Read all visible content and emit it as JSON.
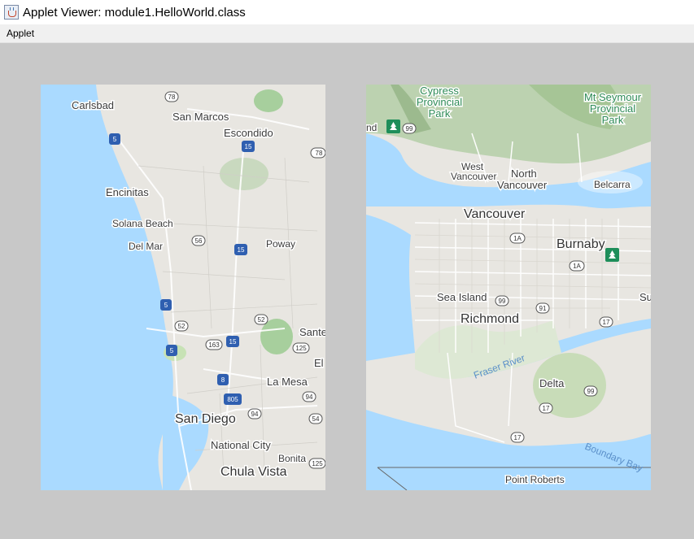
{
  "window": {
    "title": "Applet Viewer: module1.HelloWorld.class"
  },
  "menu": {
    "items": [
      "Applet"
    ]
  },
  "maps": {
    "san_diego": {
      "places": [
        "Carlsbad",
        "San Marcos",
        "Escondido",
        "Encinitas",
        "Solana Beach",
        "Del Mar",
        "Poway",
        "Sante",
        "El Ca",
        "La Mesa",
        "San Diego",
        "National City",
        "Bonita",
        "Chula Vista"
      ],
      "shields": [
        "78",
        "5",
        "15",
        "78",
        "56",
        "15",
        "5",
        "52",
        "52",
        "163",
        "15",
        "5",
        "125",
        "8",
        "805",
        "94",
        "94",
        "54",
        "125"
      ]
    },
    "vancouver": {
      "places": [
        "Cypress",
        "Provincial",
        "Park",
        "Mt Seymour",
        "Provincial",
        "Park",
        "nd",
        "West",
        "Vancouver",
        "North",
        "Vancouver",
        "Belcarra",
        "Vancouver",
        "Burnaby",
        "Sea Island",
        "Richmond",
        "Delta",
        "Point Roberts",
        "Su"
      ],
      "water": [
        "Fraser River",
        "Boundary Bay"
      ],
      "shields": [
        "99",
        "1A",
        "1A",
        "99",
        "91",
        "17",
        "99",
        "17",
        "17"
      ]
    }
  }
}
